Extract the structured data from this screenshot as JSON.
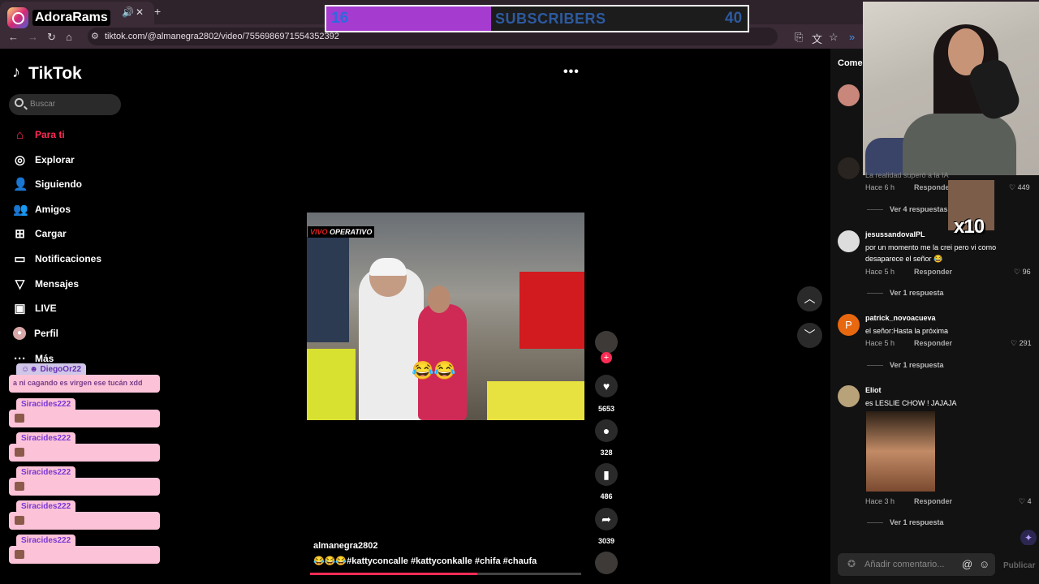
{
  "browser": {
    "tab_title": "",
    "overlay_name": "AdoraRams",
    "url": "tiktok.com/@almanegra2802/video/7556986971554352392"
  },
  "subscriber_goal": {
    "current": "16",
    "label": "SUBSCRIBERS",
    "goal": "40",
    "progress_fraction": 0.4
  },
  "sidebar": {
    "brand": "TikTok",
    "search_placeholder": "Buscar",
    "nav": [
      {
        "label": "Para ti",
        "icon": "home-icon"
      },
      {
        "label": "Explorar",
        "icon": "compass-icon"
      },
      {
        "label": "Siguiendo",
        "icon": "following-icon"
      },
      {
        "label": "Amigos",
        "icon": "friends-icon"
      },
      {
        "label": "Cargar",
        "icon": "upload-icon"
      },
      {
        "label": "Notificaciones",
        "icon": "notifications-icon"
      },
      {
        "label": "Mensajes",
        "icon": "messages-icon"
      },
      {
        "label": "LIVE",
        "icon": "live-icon"
      },
      {
        "label": "Perfil",
        "icon": "profile-icon"
      },
      {
        "label": "Más",
        "icon": "more-icon"
      }
    ]
  },
  "chat": [
    {
      "user": "DiegoOr22",
      "message": "a ni cagando es virgen ese tucán xdd"
    },
    {
      "user": "Siracides222",
      "message": ""
    },
    {
      "user": "Siracides222",
      "message": ""
    },
    {
      "user": "Siracides222",
      "message": ""
    },
    {
      "user": "Siracides222",
      "message": ""
    },
    {
      "user": "Siracides222",
      "message": ""
    }
  ],
  "video": {
    "live_tag_prefix": "VIVO",
    "live_tag": "OPERATIVO",
    "emoji_overlay": "😂😂",
    "author": "almanegra2802",
    "caption": "😂😂😂#kattyconcalle #kattyconkalle #chifa #chaufa",
    "likes": "5653",
    "comments": "328",
    "saves": "486",
    "shares": "3039",
    "progress_fraction": 0.62
  },
  "comments_panel": {
    "title": "Comen",
    "items": [
      {
        "user": "",
        "text": "La realidad superó a la IA",
        "time": "Hace 6 h",
        "reply": "Responder",
        "likes": "449",
        "replies": "Ver 4 respuestas"
      },
      {
        "user": "jesussandovalPL",
        "text": "por un momento me la crei pero vi como desaparece el señor 😂",
        "time": "Hace 5 h",
        "reply": "Responder",
        "likes": "96",
        "replies": "Ver 1 respuesta"
      },
      {
        "user": "patrick_novoacueva",
        "avatar_letter": "P",
        "text": "el señor:Hasta la próxima",
        "time": "Hace 5 h",
        "reply": "Responder",
        "likes": "291",
        "replies": "Ver 1 respuesta"
      },
      {
        "user": "Eliot",
        "text": "es LESLIE CHOW ! JAJAJA",
        "time": "Hace 3 h",
        "reply": "Responder",
        "likes": "4",
        "replies": "Ver 1 respuesta"
      }
    ],
    "meme_text": "x10",
    "input_placeholder": "Añadir comentario...",
    "post_label": "Publicar"
  }
}
